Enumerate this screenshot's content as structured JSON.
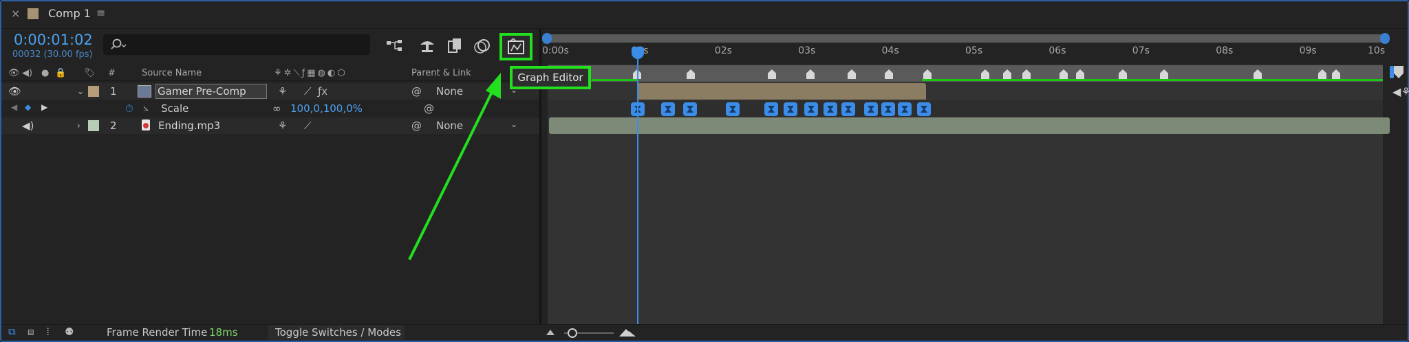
{
  "tab": {
    "close_glyph": "×",
    "title": "Comp 1",
    "menu_glyph": "≡",
    "swatch_color": "#a69374"
  },
  "time": {
    "timecode": "0:00:01:02",
    "frames": "00032 (30.00 fps)"
  },
  "search": {
    "icon": "search-icon",
    "placeholder": ""
  },
  "columns": {
    "hash": "#",
    "source_name": "Source Name",
    "parent_link": "Parent & Link"
  },
  "layers": [
    {
      "index": "1",
      "name": "Gamer Pre-Comp",
      "parent": "None",
      "label_color": "#b59d7a",
      "expanded": true
    },
    {
      "index": "2",
      "name": "Ending.mp3",
      "parent": "None",
      "label_color": "#b8cdb6",
      "expanded": false
    }
  ],
  "property": {
    "name": "Scale",
    "value": "100,0,100,0%"
  },
  "tooltip": "Graph Editor",
  "ruler": [
    "0:00s",
    "01s",
    "02s",
    "03s",
    "04s",
    "05s",
    "06s",
    "07s",
    "08s",
    "09s",
    "10s"
  ],
  "bottom": {
    "frame_render_label": "Frame Render Time",
    "frame_render_value": "18ms",
    "toggle_label": "Toggle Switches / Modes"
  },
  "colors": {
    "accent_blue": "#3b8de8",
    "highlight_green": "#22e01e",
    "render_time_green": "#7fd46a"
  }
}
